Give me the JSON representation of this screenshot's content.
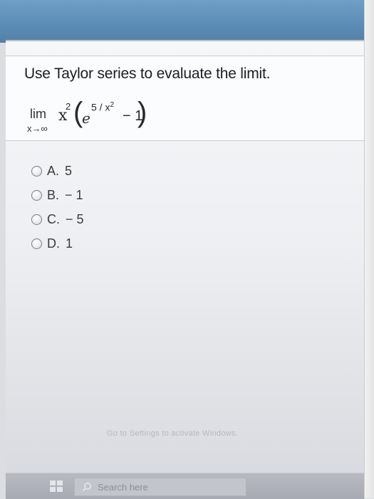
{
  "question": {
    "prompt": "Use Taylor series to evaluate the limit.",
    "limit_word": "lim",
    "limit_sub": "x→∞",
    "expr": {
      "base": "x",
      "base_exp": "2",
      "lparen": "(",
      "e": "e",
      "exponent": "5 / x",
      "exponent_sup": "2",
      "minus_one": "− 1",
      "rparen": ")"
    }
  },
  "options": [
    {
      "letter": "A.",
      "value": "5"
    },
    {
      "letter": "B.",
      "value": "− 1"
    },
    {
      "letter": "C.",
      "value": "− 5"
    },
    {
      "letter": "D.",
      "value": "1"
    }
  ],
  "taskbar": {
    "search_placeholder": "Search here",
    "overlay": "Go to Settings to activate Windows."
  },
  "icons": {
    "windows": "windows-logo-icon",
    "search": "search-icon",
    "radio": "radio-button-icon"
  }
}
